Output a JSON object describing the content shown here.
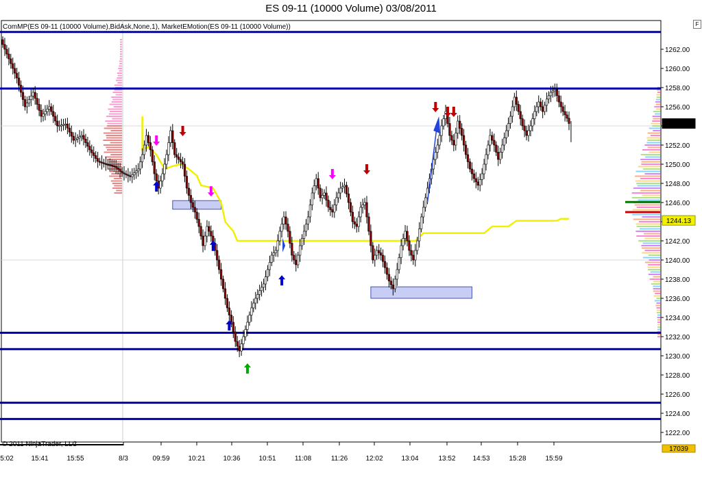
{
  "window": {
    "title": "ES 09-11 (10000 Volume)  03/08/2011",
    "indicator_label": "ComMP(ES 09-11 (10000 Volume),BidAsk,None,1), MarketEMotion(ES 09-11 (10000 Volume))",
    "copyright": "© 2011 NinjaTrader, LLC",
    "f_button": "F"
  },
  "chart_data": {
    "type": "candlestick",
    "title": "ES 09-11 (10000 Volume)  03/08/2011",
    "ylim": [
      1221,
      1265
    ],
    "y_ticks": [
      1222,
      1224,
      1226,
      1228,
      1230,
      1232,
      1234,
      1236,
      1238,
      1240,
      1242,
      1244,
      1246,
      1248,
      1250,
      1252,
      1254,
      1256,
      1258,
      1260,
      1262
    ],
    "y_tick_labels": [
      "1222.00",
      "1224.00",
      "1226.00",
      "1228.00",
      "1230.00",
      "1232.00",
      "1234.00",
      "1236.00",
      "1238.00",
      "1240.00",
      "1242.00",
      "1244.00",
      "1246.00",
      "1248.00",
      "1250.00",
      "1252.00",
      "1254.00",
      "1256.00",
      "1258.00",
      "1260.00",
      "1262.00"
    ],
    "x_tick_labels": [
      "5:02",
      "15:41",
      "15:55",
      "8/3",
      "09:59",
      "10:21",
      "10:36",
      "10:51",
      "11:08",
      "11:26",
      "12:02",
      "13:04",
      "13:52",
      "14:53",
      "15:28",
      "15:59"
    ],
    "last_price": "1254.25",
    "vwap_price": "1244.13",
    "volume_readout": "17039",
    "horizontal_levels": [
      1263.8,
      1257.9,
      1232.4,
      1230.7,
      1225.1,
      1223.4
    ],
    "price_path": [
      [
        0,
        1263
      ],
      [
        4,
        1261
      ],
      [
        8,
        1259
      ],
      [
        12,
        1256
      ],
      [
        16,
        1257.5
      ],
      [
        20,
        1255
      ],
      [
        24,
        1256
      ],
      [
        28,
        1254
      ],
      [
        32,
        1254.2
      ],
      [
        36,
        1252.5
      ],
      [
        40,
        1253
      ],
      [
        44,
        1251.5
      ],
      [
        48,
        1250.3
      ],
      [
        52,
        1250
      ],
      [
        56,
        1249.8
      ],
      [
        60,
        1249.1
      ],
      [
        64,
        1248.7
      ],
      [
        68,
        1249.5
      ],
      [
        70,
        1251
      ],
      [
        72,
        1253
      ],
      [
        74,
        1251.5
      ],
      [
        76,
        1249
      ],
      [
        78,
        1247.5
      ],
      [
        80,
        1249
      ],
      [
        82,
        1251
      ],
      [
        84,
        1253.5
      ],
      [
        86,
        1251
      ],
      [
        88,
        1250.5
      ],
      [
        90,
        1250
      ],
      [
        92,
        1247.5
      ],
      [
        94,
        1246
      ],
      [
        96,
        1245
      ],
      [
        98,
        1243.5
      ],
      [
        100,
        1241.5
      ],
      [
        102,
        1243.5
      ],
      [
        104,
        1242.5
      ],
      [
        106,
        1241
      ],
      [
        108,
        1239
      ],
      [
        110,
        1237
      ],
      [
        112,
        1235
      ],
      [
        114,
        1233.5
      ],
      [
        116,
        1231.5
      ],
      [
        118,
        1230.5
      ],
      [
        120,
        1232
      ],
      [
        122,
        1233.5
      ],
      [
        124,
        1235
      ],
      [
        126,
        1236
      ],
      [
        128,
        1236.8
      ],
      [
        130,
        1237.5
      ],
      [
        132,
        1239
      ],
      [
        134,
        1240.5
      ],
      [
        136,
        1241
      ],
      [
        138,
        1243
      ],
      [
        140,
        1244.5
      ],
      [
        142,
        1243
      ],
      [
        144,
        1240.5
      ],
      [
        146,
        1239.5
      ],
      [
        148,
        1241.5
      ],
      [
        150,
        1243
      ],
      [
        152,
        1244.5
      ],
      [
        154,
        1247
      ],
      [
        156,
        1248.5
      ],
      [
        158,
        1246.5
      ],
      [
        160,
        1247
      ],
      [
        162,
        1245.5
      ],
      [
        164,
        1245
      ],
      [
        166,
        1246.5
      ],
      [
        168,
        1247.5
      ],
      [
        170,
        1247.8
      ],
      [
        172,
        1246
      ],
      [
        174,
        1244
      ],
      [
        176,
        1243.5
      ],
      [
        178,
        1245.5
      ],
      [
        180,
        1246
      ],
      [
        182,
        1243
      ],
      [
        184,
        1240
      ],
      [
        186,
        1241
      ],
      [
        188,
        1240.5
      ],
      [
        190,
        1239.2
      ],
      [
        192,
        1237.8
      ],
      [
        194,
        1237
      ],
      [
        196,
        1239
      ],
      [
        198,
        1241.5
      ],
      [
        200,
        1243
      ],
      [
        202,
        1241
      ],
      [
        204,
        1240
      ],
      [
        206,
        1242
      ],
      [
        208,
        1244.5
      ],
      [
        210,
        1246.5
      ],
      [
        212,
        1248.5
      ],
      [
        214,
        1250.5
      ],
      [
        216,
        1252
      ],
      [
        218,
        1254
      ],
      [
        220,
        1255.5
      ],
      [
        222,
        1253
      ],
      [
        224,
        1252
      ],
      [
        226,
        1254.5
      ],
      [
        228,
        1253
      ],
      [
        230,
        1251
      ],
      [
        232,
        1249.5
      ],
      [
        234,
        1248.5
      ],
      [
        236,
        1247.8
      ],
      [
        238,
        1249
      ],
      [
        240,
        1251
      ],
      [
        242,
        1253
      ],
      [
        244,
        1252
      ],
      [
        246,
        1250.5
      ],
      [
        248,
        1252
      ],
      [
        250,
        1253.5
      ],
      [
        252,
        1255
      ],
      [
        254,
        1257
      ],
      [
        256,
        1255.5
      ],
      [
        258,
        1254
      ],
      [
        260,
        1253
      ],
      [
        262,
        1254
      ],
      [
        264,
        1255.5
      ],
      [
        266,
        1256.5
      ],
      [
        268,
        1255.5
      ],
      [
        270,
        1256.8
      ],
      [
        272,
        1257.5
      ],
      [
        274,
        1257.8
      ],
      [
        276,
        1256.5
      ],
      [
        278,
        1255.5
      ],
      [
        280,
        1254.8
      ],
      [
        281,
        1254.25
      ]
    ],
    "vwap_line": [
      [
        69,
        1255
      ],
      [
        69,
        1251.5
      ],
      [
        72,
        1251.8
      ],
      [
        76,
        1251
      ],
      [
        80,
        1249.5
      ],
      [
        84,
        1249.8
      ],
      [
        88,
        1250
      ],
      [
        92,
        1249.5
      ],
      [
        96,
        1248.8
      ],
      [
        98,
        1247.8
      ],
      [
        104,
        1247.5
      ],
      [
        108,
        1246
      ],
      [
        110,
        1244
      ],
      [
        114,
        1243
      ],
      [
        116,
        1242
      ],
      [
        120,
        1242
      ],
      [
        200,
        1242
      ],
      [
        204,
        1242
      ],
      [
        208,
        1242.8
      ],
      [
        220,
        1242.8
      ],
      [
        238,
        1242.8
      ],
      [
        242,
        1243.5
      ],
      [
        250,
        1243.5
      ],
      [
        254,
        1244.1
      ],
      [
        274,
        1244.1
      ],
      [
        276,
        1244.3
      ],
      [
        280,
        1244.3
      ]
    ],
    "boxes": [
      {
        "x1": 84,
        "x2": 108,
        "y1": 1246.2,
        "y2": 1245.3
      },
      {
        "x1": 182,
        "x2": 232,
        "y1": 1237.2,
        "y2": 1236
      }
    ],
    "arrows": [
      {
        "x": 89,
        "y": 1253,
        "dir": "down",
        "color": "#c00000"
      },
      {
        "x": 180,
        "y": 1249,
        "dir": "down",
        "color": "#c00000"
      },
      {
        "x": 214,
        "y": 1255.5,
        "dir": "down",
        "color": "#c00000"
      },
      {
        "x": 220,
        "y": 1255,
        "dir": "down",
        "color": "#c00000"
      },
      {
        "x": 223,
        "y": 1255,
        "dir": "down",
        "color": "#c00000"
      },
      {
        "x": 76,
        "y": 1252,
        "dir": "down",
        "color": "#ff00ff"
      },
      {
        "x": 103,
        "y": 1246.7,
        "dir": "down",
        "color": "#ff00ff"
      },
      {
        "x": 163,
        "y": 1248.5,
        "dir": "down",
        "color": "#ff00ff"
      },
      {
        "x": 76,
        "y": 1248,
        "dir": "up",
        "color": "#0000cc"
      },
      {
        "x": 104,
        "y": 1241.8,
        "dir": "up",
        "color": "#0000cc"
      },
      {
        "x": 138,
        "y": 1238.2,
        "dir": "up",
        "color": "#0000cc"
      },
      {
        "x": 112,
        "y": 1233.5,
        "dir": "up",
        "color": "#0000cc"
      },
      {
        "x": 121,
        "y": 1229,
        "dir": "up",
        "color": "#00aa00"
      }
    ]
  }
}
